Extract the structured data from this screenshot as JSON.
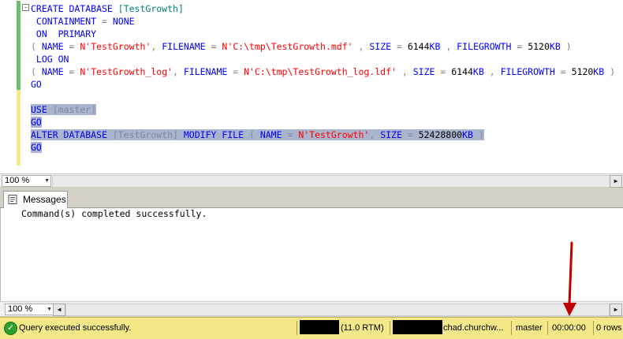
{
  "editor": {
    "collapse_glyph": "-",
    "lines": [
      [
        [
          "kw",
          "CREATE DATABASE "
        ],
        [
          "id",
          "[TestGrowth]"
        ]
      ],
      [
        [
          "kw",
          " CONTAINMENT "
        ],
        [
          "gr",
          "= "
        ],
        [
          "kw",
          "NONE"
        ]
      ],
      [
        [
          "kw",
          " ON  PRIMARY"
        ]
      ],
      [
        [
          "gr",
          "( "
        ],
        [
          "kw",
          "NAME "
        ],
        [
          "gr",
          "= "
        ],
        [
          "st",
          "N'TestGrowth'"
        ],
        [
          "gr",
          ", "
        ],
        [
          "kw",
          "FILENAME "
        ],
        [
          "gr",
          "= "
        ],
        [
          "st",
          "N'C:\\tmp\\TestGrowth.mdf'"
        ],
        [
          "gr",
          " , "
        ],
        [
          "kw",
          "SIZE "
        ],
        [
          "gr",
          "= "
        ],
        [
          "txt",
          "6144"
        ],
        [
          "kw",
          "KB"
        ],
        [
          "gr",
          " , "
        ],
        [
          "kw",
          "FILEGROWTH "
        ],
        [
          "gr",
          "= "
        ],
        [
          "txt",
          "5120"
        ],
        [
          "kw",
          "KB"
        ],
        [
          "gr",
          " )"
        ]
      ],
      [
        [
          "kw",
          " LOG ON"
        ]
      ],
      [
        [
          "gr",
          "( "
        ],
        [
          "kw",
          "NAME "
        ],
        [
          "gr",
          "= "
        ],
        [
          "st",
          "N'TestGrowth_log'"
        ],
        [
          "gr",
          ", "
        ],
        [
          "kw",
          "FILENAME "
        ],
        [
          "gr",
          "= "
        ],
        [
          "st",
          "N'C:\\tmp\\TestGrowth_log.ldf'"
        ],
        [
          "gr",
          " , "
        ],
        [
          "kw",
          "SIZE "
        ],
        [
          "gr",
          "= "
        ],
        [
          "txt",
          "6144"
        ],
        [
          "kw",
          "KB"
        ],
        [
          "gr",
          " , "
        ],
        [
          "kw",
          "FILEGROWTH "
        ],
        [
          "gr",
          "= "
        ],
        [
          "txt",
          "5120"
        ],
        [
          "kw",
          "KB"
        ],
        [
          "gr",
          " )"
        ]
      ],
      [
        [
          "kw",
          "GO"
        ]
      ],
      [],
      [
        [
          "kw",
          "USE "
        ],
        [
          "id",
          "[master]"
        ]
      ],
      [
        [
          "kw",
          "GO"
        ]
      ],
      [
        [
          "kw",
          "ALTER DATABASE "
        ],
        [
          "id",
          "[TestGrowth] "
        ],
        [
          "kw",
          "MODIFY FILE "
        ],
        [
          "gr",
          "( "
        ],
        [
          "kw",
          "NAME "
        ],
        [
          "gr",
          "= "
        ],
        [
          "st",
          "N'TestGrowth'"
        ],
        [
          "gr",
          ", "
        ],
        [
          "kw",
          "SIZE "
        ],
        [
          "gr",
          "= "
        ],
        [
          "txt",
          "52428800"
        ],
        [
          "kw",
          "KB"
        ],
        [
          "gr",
          " )"
        ]
      ],
      [
        [
          "kw",
          "GO"
        ]
      ]
    ],
    "selected_lines": [
      8,
      9,
      10,
      11
    ]
  },
  "editor_zoom": {
    "value": "100 %"
  },
  "tabs": {
    "messages_label": "Messages"
  },
  "results": {
    "text": "Command(s) completed successfully."
  },
  "results_zoom": {
    "value": "100 %"
  },
  "status": {
    "message": "Query executed successfully.",
    "version": "(11.0 RTM)",
    "user": "chad.churchw...",
    "database": "master",
    "elapsed": "00:00:00",
    "rows": "0 rows"
  },
  "colors": {
    "keyword": "#0000ff",
    "string": "#ff0000",
    "identifier": "#008080",
    "operator": "#808080",
    "selection": "#aab4cc",
    "status_bar": "#f5e888",
    "annotation_arrow": "#c00000"
  },
  "icons": {
    "messages": "messages-icon",
    "status": "check-circle-icon",
    "scroll_left": "scroll-left-icon",
    "scroll_right": "scroll-right-icon",
    "dropdown": "chevron-down-icon"
  }
}
